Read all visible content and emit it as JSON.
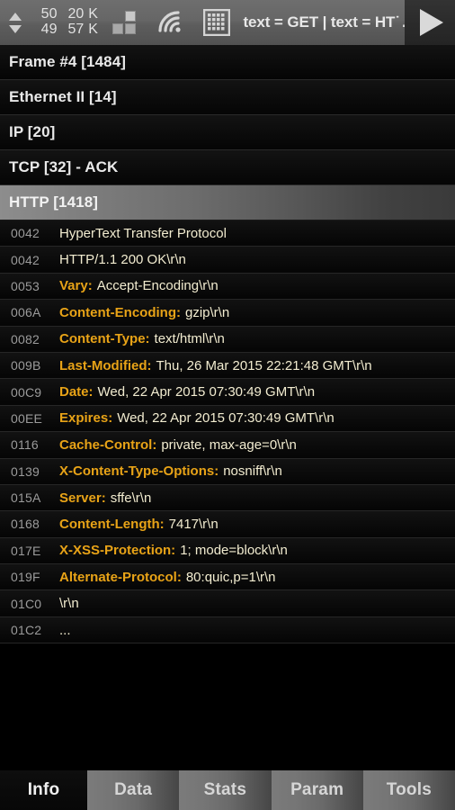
{
  "toolbar": {
    "nav_up_icon": "triangle-up-icon",
    "nav_down_icon": "triangle-down-icon",
    "packet_index": "50",
    "packet_total": "49",
    "bytes_value": "20",
    "bytes_unit": "K",
    "bytes_total_value": "57",
    "bytes_total_unit": "K",
    "blocks_icon": "blocks-icon",
    "wifi_icon": "wifi-signal-icon",
    "grid_icon": "grid-table-icon",
    "filter_text": "text = GET | text = HT˙",
    "filter_ellipsis": "...",
    "play_icon": "play-icon"
  },
  "protocol_tree": [
    {
      "label": "Frame #4 [1484]",
      "selected": false
    },
    {
      "label": "Ethernet II [14]",
      "selected": false
    },
    {
      "label": "IP [20]",
      "selected": false
    },
    {
      "label": "TCP [32] - ACK",
      "selected": false
    },
    {
      "label": "HTTP [1418]",
      "selected": true
    }
  ],
  "detail_rows": [
    {
      "offset": "0042",
      "key": "",
      "value": "HyperText Transfer Protocol"
    },
    {
      "offset": "0042",
      "key": "",
      "value": "HTTP/1.1 200 OK\\r\\n"
    },
    {
      "offset": "0053",
      "key": "Vary:",
      "value": "Accept-Encoding\\r\\n"
    },
    {
      "offset": "006A",
      "key": "Content-Encoding:",
      "value": "gzip\\r\\n"
    },
    {
      "offset": "0082",
      "key": "Content-Type:",
      "value": "text/html\\r\\n"
    },
    {
      "offset": "009B",
      "key": "Last-Modified:",
      "value": "Thu, 26 Mar 2015 22:21:48 GMT\\r\\n"
    },
    {
      "offset": "00C9",
      "key": "Date:",
      "value": "Wed, 22 Apr 2015 07:30:49 GMT\\r\\n"
    },
    {
      "offset": "00EE",
      "key": "Expires:",
      "value": "Wed, 22 Apr 2015 07:30:49 GMT\\r\\n"
    },
    {
      "offset": "0116",
      "key": "Cache-Control:",
      "value": "private, max-age=0\\r\\n"
    },
    {
      "offset": "0139",
      "key": "X-Content-Type-Options:",
      "value": "nosniff\\r\\n"
    },
    {
      "offset": "015A",
      "key": "Server:",
      "value": "sffe\\r\\n"
    },
    {
      "offset": "0168",
      "key": "Content-Length:",
      "value": "7417\\r\\n"
    },
    {
      "offset": "017E",
      "key": "X-XSS-Protection:",
      "value": "1; mode=block\\r\\n"
    },
    {
      "offset": "019F",
      "key": "Alternate-Protocol:",
      "value": "80:quic,p=1\\r\\n"
    },
    {
      "offset": "01C0",
      "key": "",
      "value": "\\r\\n"
    },
    {
      "offset": "01C2",
      "key": "",
      "value": "..."
    }
  ],
  "tabs": [
    {
      "label": "Info",
      "active": true
    },
    {
      "label": "Data",
      "active": false
    },
    {
      "label": "Stats",
      "active": false
    },
    {
      "label": "Param",
      "active": false
    },
    {
      "label": "Tools",
      "active": false
    }
  ],
  "colors": {
    "header_key": "#E8A317",
    "header_value": "#F2ECD0",
    "offset": "#9B9B9B",
    "toolbar_bg": "#666666",
    "background": "#000000"
  }
}
